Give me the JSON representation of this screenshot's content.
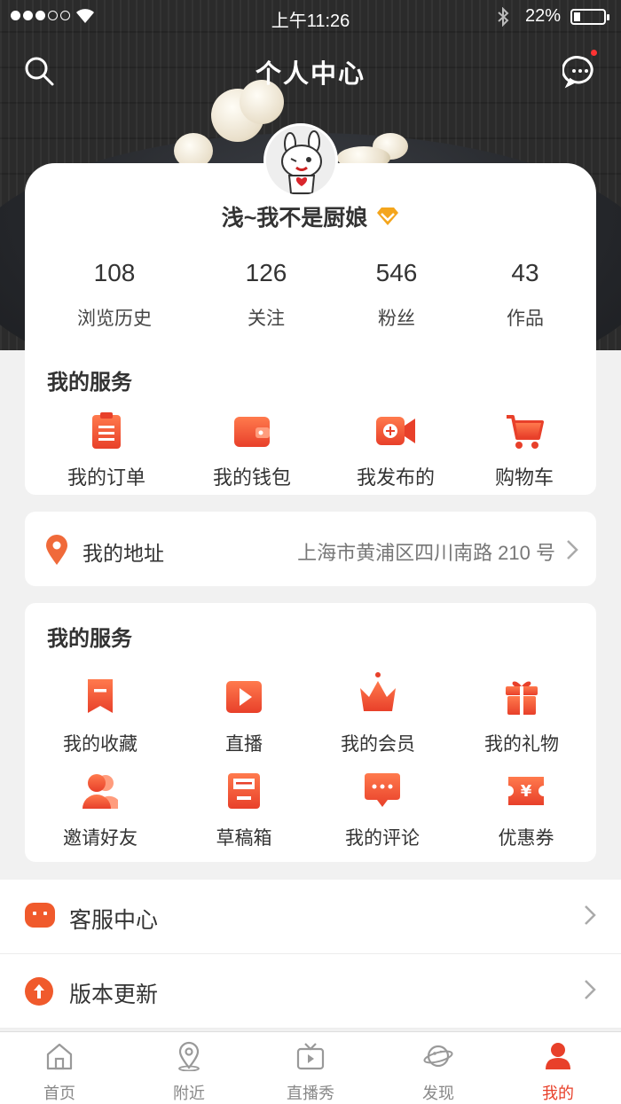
{
  "status_bar": {
    "time": "上午11:26",
    "battery": "22%",
    "battery_level": 0.22
  },
  "header": {
    "title": "个人中心"
  },
  "profile": {
    "nickname": "浅~我不是厨娘",
    "stats": [
      {
        "value": "108",
        "label": "浏览历史"
      },
      {
        "value": "126",
        "label": "关注"
      },
      {
        "value": "546",
        "label": "粉丝"
      },
      {
        "value": "43",
        "label": "作品"
      }
    ]
  },
  "services_1": {
    "title": "我的服务",
    "items": [
      {
        "label": "我的订单",
        "icon": "clipboard-icon"
      },
      {
        "label": "我的钱包",
        "icon": "wallet-icon"
      },
      {
        "label": "我发布的",
        "icon": "video-add-icon"
      },
      {
        "label": "购物车",
        "icon": "cart-icon"
      }
    ]
  },
  "address": {
    "label": "我的地址",
    "value": "上海市黄浦区四川南路 210 号"
  },
  "services_2": {
    "title": "我的服务",
    "items": [
      {
        "label": "我的收藏",
        "icon": "bookmark-icon"
      },
      {
        "label": "直播",
        "icon": "play-icon"
      },
      {
        "label": "我的会员",
        "icon": "crown-icon"
      },
      {
        "label": "我的礼物",
        "icon": "gift-icon"
      },
      {
        "label": "邀请好友",
        "icon": "invite-icon"
      },
      {
        "label": "草稿箱",
        "icon": "drafts-icon"
      },
      {
        "label": "我的评论",
        "icon": "comment-icon"
      },
      {
        "label": "优惠券",
        "icon": "coupon-icon"
      }
    ]
  },
  "rows": [
    {
      "label": "客服中心",
      "icon": "customer-service-icon"
    },
    {
      "label": "版本更新",
      "icon": "update-icon"
    }
  ],
  "tabbar": [
    {
      "label": "首页",
      "icon": "home-icon"
    },
    {
      "label": "附近",
      "icon": "location-icon"
    },
    {
      "label": "直播秀",
      "icon": "tv-icon"
    },
    {
      "label": "发现",
      "icon": "planet-icon"
    },
    {
      "label": "我的",
      "icon": "user-icon",
      "active": true
    }
  ],
  "colors": {
    "accent": "#e8402a",
    "accent_light": "#ff6d4a",
    "gold": "#f4a51c"
  }
}
